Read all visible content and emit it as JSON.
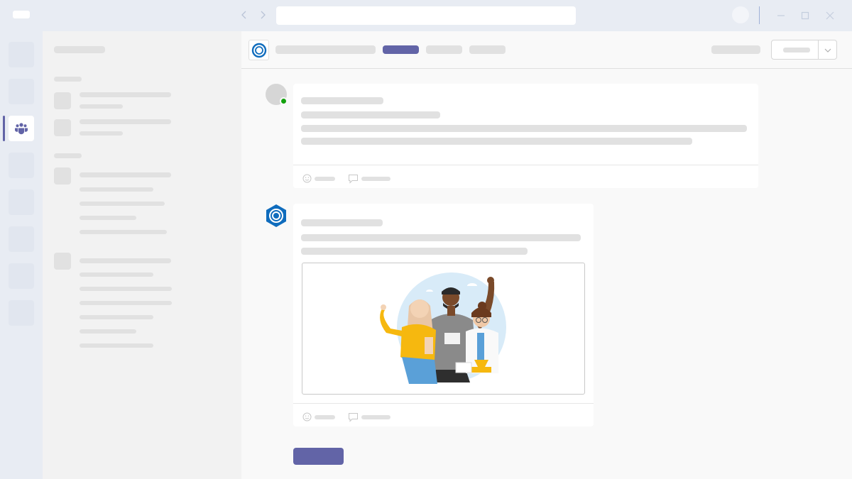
{
  "titlebar": {
    "back_icon": "chevron-left-icon",
    "forward_icon": "chevron-right-icon",
    "search_placeholder": "",
    "window_controls": [
      "minimize-icon",
      "maximize-icon",
      "close-icon"
    ]
  },
  "rail": {
    "active_icon": "teams-icon",
    "active_index": 2,
    "accent": "#6264a7"
  },
  "channel_header": {
    "app_icon": "bot-app-icon",
    "active_tab_color": "#6264a7"
  },
  "messages": [
    {
      "avatar": "user-avatar",
      "presence": "online",
      "presence_color": "#13a10e"
    },
    {
      "avatar": "bot-avatar",
      "illustration": "team-people-illustration"
    }
  ],
  "colors": {
    "brand": "#6264a7",
    "bot_blue": "#0f6cbd"
  }
}
